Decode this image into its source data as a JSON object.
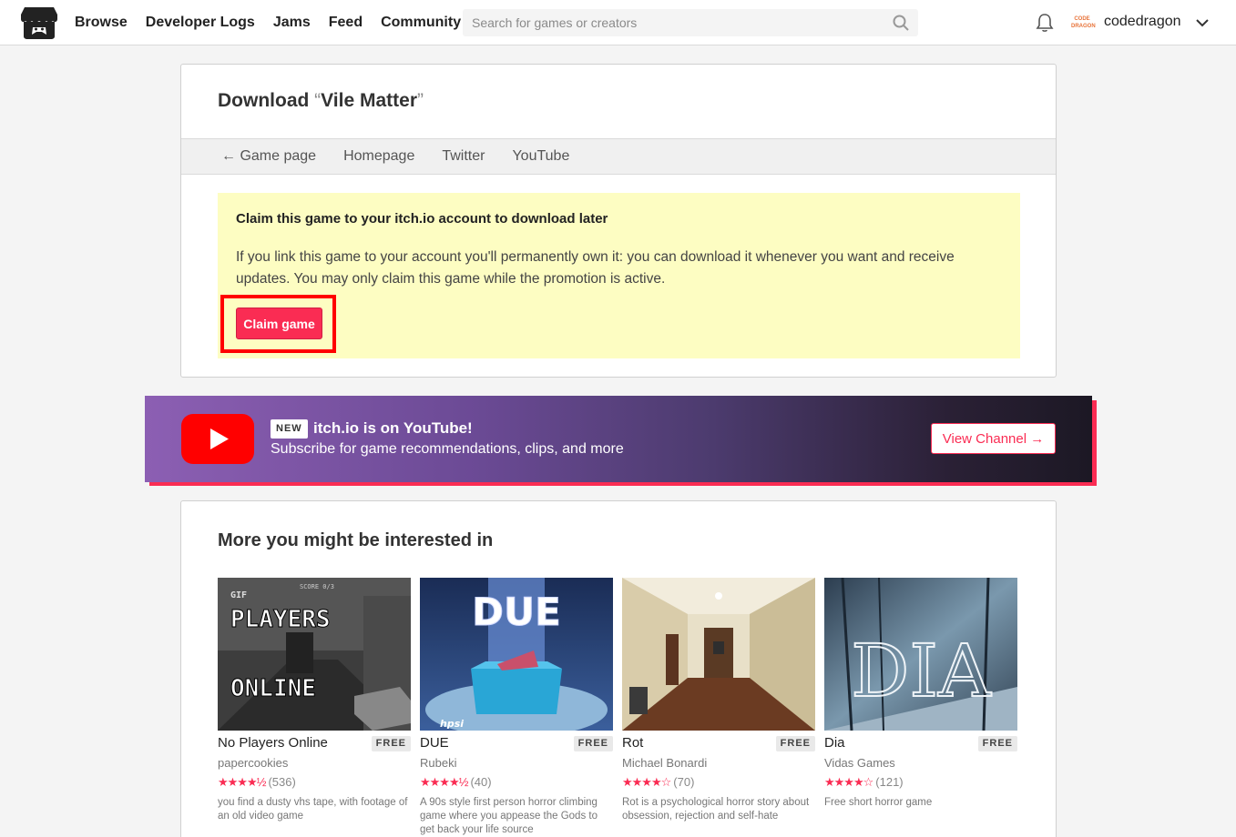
{
  "header": {
    "nav": [
      "Browse",
      "Developer Logs",
      "Jams",
      "Feed",
      "Community"
    ],
    "search_placeholder": "Search for games or creators",
    "avatar_text": "CODE DRAGON",
    "username": "codedragon"
  },
  "download": {
    "title_prefix": "Download ",
    "open_quote": "“",
    "game_title": "Vile Matter",
    "close_quote": "”",
    "links": [
      "← Game page",
      "Homepage",
      "Twitter",
      "YouTube"
    ],
    "claim_title": "Claim this game to your itch.io account to download later",
    "claim_text": "If you link this game to your account you'll permanently own it: you can download it whenever you want and receive updates. You may only claim this game while the promotion is active.",
    "claim_button": "Claim game"
  },
  "youtube_banner": {
    "badge": "NEW",
    "title": "itch.io is on YouTube!",
    "subtitle": "Subscribe for game recommendations, clips, and more",
    "button": "View Channel →"
  },
  "more": {
    "title": "More you might be interested in",
    "games": [
      {
        "name": "No Players Online",
        "price": "FREE",
        "author": "papercookies",
        "stars": "★★★★½",
        "rating": 4.5,
        "reviews": "(536)",
        "desc": "you find a dusty vhs tape, with footage of an old video game",
        "thumb_text": [
          "GIF",
          "PLAYERS",
          "ONLINE"
        ],
        "thumb_score": "SCORE 0/3"
      },
      {
        "name": "DUE",
        "price": "FREE",
        "author": "Rubeki",
        "stars": "★★★★½",
        "rating": 4.5,
        "reviews": "(40)",
        "desc": "A 90s style first person horror climbing game where you appease the Gods to get back your life source",
        "thumb_text": [
          "DUE"
        ],
        "thumb_label": "hpsi"
      },
      {
        "name": "Rot",
        "price": "FREE",
        "author": "Michael Bonardi",
        "stars": "★★★★☆",
        "rating": 4,
        "reviews": "(70)",
        "desc": "Rot is a psychological horror story about obsession, rejection and self-hate"
      },
      {
        "name": "Dia",
        "price": "FREE",
        "author": "Vidas Games",
        "stars": "★★★★☆",
        "rating": 4,
        "reviews": "(121)",
        "desc": "Free short horror game",
        "thumb_text": [
          "DIA"
        ]
      }
    ]
  },
  "colors": {
    "accent": "#fa2c53",
    "highlight_border": "#ff0000",
    "claim_bg": "#fdfdc2"
  }
}
